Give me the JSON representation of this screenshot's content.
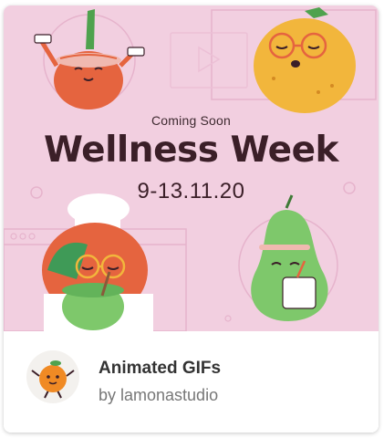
{
  "card": {
    "thumbnail": {
      "subtitle": "Coming Soon",
      "headline": "Wellness Week",
      "dates": "9-13.11.20"
    },
    "collection_title": "Animated GIFs",
    "author_line": "by lamonastudio"
  },
  "colors": {
    "thumbnail_background": "#f2cfe0",
    "headline_text": "#3b1f28",
    "title_text": "#333333",
    "author_text": "#777777"
  },
  "icons": [
    "tomato-character",
    "lemon-character",
    "apple-chef-character",
    "pear-character",
    "play-icon",
    "orange-avatar"
  ]
}
